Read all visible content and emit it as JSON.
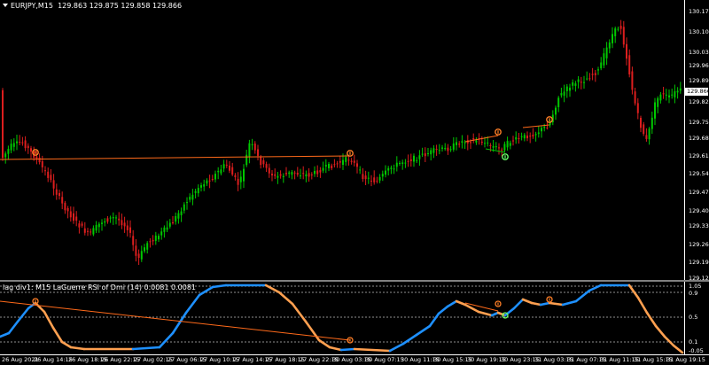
{
  "main_chart": {
    "symbol": "EURJPY,M15",
    "ohlc": "129.863 129.875 129.858 129.866",
    "current_price": "129.866",
    "price_levels": [
      "130.175",
      "130.105",
      "130.035",
      "129.965",
      "129.895",
      "129.825",
      "129.755",
      "129.685",
      "129.615",
      "129.545",
      "129.475",
      "129.405",
      "129.335",
      "129.265",
      "129.195",
      "129.125"
    ]
  },
  "indicator": {
    "title": "lag div1: M15 LaGuerre RSI of Dmi (14) 0.0081 0.0081",
    "levels": [
      "1.05",
      "0.9",
      "0.5",
      "0.1",
      "-0.05"
    ]
  },
  "time_axis": {
    "labels": [
      "26 Aug 2021",
      "26 Aug 14:15",
      "26 Aug 18:15",
      "26 Aug 22:15",
      "27 Aug 02:15",
      "27 Aug 06:15",
      "27 Aug 10:15",
      "27 Aug 14:15",
      "27 Aug 18:15",
      "27 Aug 22:15",
      "30 Aug 03:15",
      "30 Aug 07:15",
      "30 Aug 11:15",
      "30 Aug 15:15",
      "30 Aug 19:15",
      "30 Aug 23:15",
      "31 Aug 03:15",
      "31 Aug 07:15",
      "31 Aug 11:15",
      "31 Aug 15:15",
      "31 Aug 19:15"
    ]
  },
  "colors": {
    "background": "#000000",
    "bull_candle": "#00c800",
    "bear_candle": "#dc1e1e",
    "divergence_line": "#ff6a1a",
    "rsi_up": "#1e90ff",
    "rsi_down": "#ffa050",
    "grid_level": "#c0c0c0",
    "arrow_bear": "#ff7f27",
    "arrow_bull": "#66ff66"
  }
}
